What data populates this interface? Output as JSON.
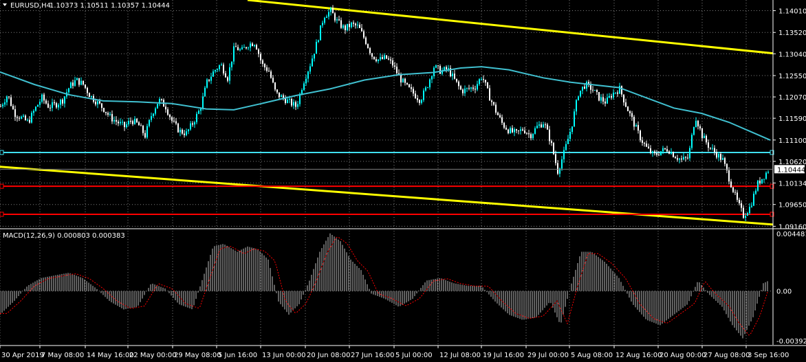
{
  "header": {
    "symbol": "EURUSD,H4",
    "ohlc": "1.10373 1.10511 1.10357 1.10444",
    "dropdown_icon": "triangle-down-icon"
  },
  "colors": {
    "background": "#000000",
    "grid": "#808080",
    "bull_candle": "#00FFFF",
    "bear_candle": "#FFFFFF",
    "ma_line": "#40C0D0",
    "trendline": "#FFFF00",
    "support_line": "#FF0000",
    "resistance_line": "#40E0F0",
    "macd_hist": "#C0C0C0",
    "macd_signal": "#FF0000",
    "price_tag": "#FFFFFF"
  },
  "chart_data": {
    "type": "candlestick",
    "symbol": "EURUSD",
    "timeframe": "H4",
    "price_axis": {
      "ticks": [
        "1.14010",
        "1.13520",
        "1.13040",
        "1.12550",
        "1.12070",
        "1.11590",
        "1.11100",
        "1.10620",
        "1.10134",
        "1.09650",
        "1.09160"
      ],
      "range": [
        1.0912,
        1.1425
      ],
      "current_price": "1.10444"
    },
    "time_axis": {
      "ticks": [
        "30 Apr 2019",
        "7 May 08:00",
        "14 May 16:00",
        "22 May 00:00",
        "29 May 08:00",
        "5 Jun 16:00",
        "13 Jun 00:00",
        "20 Jun 08:00",
        "27 Jun 16:00",
        "5 Jul 00:00",
        "12 Jul 08:00",
        "19 Jul 16:00",
        "29 Jul 00:00",
        "5 Aug 08:00",
        "12 Aug 16:00",
        "20 Aug 00:00",
        "27 Aug 08:00",
        "3 Sep 16:00"
      ]
    },
    "close_path": [
      [
        0,
        1.1186
      ],
      [
        10,
        1.1212
      ],
      [
        20,
        1.117
      ],
      [
        30,
        1.116
      ],
      [
        40,
        1.115
      ],
      [
        50,
        1.118
      ],
      [
        60,
        1.1205
      ],
      [
        70,
        1.1185
      ],
      [
        80,
        1.119
      ],
      [
        90,
        1.12
      ],
      [
        100,
        1.123
      ],
      [
        110,
        1.1245
      ],
      [
        120,
        1.1235
      ],
      [
        130,
        1.121
      ],
      [
        140,
        1.1195
      ],
      [
        150,
        1.118
      ],
      [
        160,
        1.116
      ],
      [
        170,
        1.115
      ],
      [
        180,
        1.114
      ],
      [
        190,
        1.1155
      ],
      [
        200,
        1.1145
      ],
      [
        210,
        1.112
      ],
      [
        220,
        1.117
      ],
      [
        230,
        1.12
      ],
      [
        240,
        1.1185
      ],
      [
        250,
        1.115
      ],
      [
        260,
        1.113
      ],
      [
        270,
        1.1125
      ],
      [
        280,
        1.115
      ],
      [
        290,
        1.118
      ],
      [
        300,
        1.124
      ],
      [
        310,
        1.1265
      ],
      [
        320,
        1.128
      ],
      [
        330,
        1.125
      ],
      [
        340,
        1.132
      ],
      [
        350,
        1.131
      ],
      [
        360,
        1.1325
      ],
      [
        370,
        1.133
      ],
      [
        380,
        1.128
      ],
      [
        390,
        1.1265
      ],
      [
        400,
        1.1215
      ],
      [
        410,
        1.1205
      ],
      [
        420,
        1.1195
      ],
      [
        430,
        1.1185
      ],
      [
        440,
        1.124
      ],
      [
        450,
        1.128
      ],
      [
        460,
        1.133
      ],
      [
        470,
        1.139
      ],
      [
        480,
        1.14
      ],
      [
        490,
        1.1375
      ],
      [
        500,
        1.136
      ],
      [
        510,
        1.137
      ],
      [
        520,
        1.1365
      ],
      [
        530,
        1.1335
      ],
      [
        540,
        1.13
      ],
      [
        550,
        1.129
      ],
      [
        560,
        1.1295
      ],
      [
        570,
        1.128
      ],
      [
        580,
        1.125
      ],
      [
        590,
        1.123
      ],
      [
        600,
        1.1215
      ],
      [
        610,
        1.12
      ],
      [
        620,
        1.123
      ],
      [
        630,
        1.1275
      ],
      [
        640,
        1.1265
      ],
      [
        650,
        1.127
      ],
      [
        660,
        1.1245
      ],
      [
        670,
        1.122
      ],
      [
        680,
        1.1225
      ],
      [
        690,
        1.123
      ],
      [
        700,
        1.1255
      ],
      [
        710,
        1.121
      ],
      [
        720,
        1.1175
      ],
      [
        730,
        1.1145
      ],
      [
        740,
        1.113
      ],
      [
        750,
        1.1125
      ],
      [
        760,
        1.1135
      ],
      [
        770,
        1.112
      ],
      [
        780,
        1.114
      ],
      [
        790,
        1.115
      ],
      [
        800,
        1.1105
      ],
      [
        810,
        1.104
      ],
      [
        820,
        1.1085
      ],
      [
        830,
        1.114
      ],
      [
        840,
        1.1215
      ],
      [
        850,
        1.1235
      ],
      [
        860,
        1.1225
      ],
      [
        870,
        1.1205
      ],
      [
        880,
        1.1195
      ],
      [
        890,
        1.1215
      ],
      [
        900,
        1.1225
      ],
      [
        910,
        1.1185
      ],
      [
        920,
        1.115
      ],
      [
        930,
        1.1115
      ],
      [
        940,
        1.109
      ],
      [
        950,
        1.1075
      ],
      [
        960,
        1.1085
      ],
      [
        970,
        1.109
      ],
      [
        980,
        1.1075
      ],
      [
        990,
        1.1065
      ],
      [
        1000,
        1.107
      ],
      [
        1010,
        1.1165
      ],
      [
        1020,
        1.112
      ],
      [
        1030,
        1.1095
      ],
      [
        1040,
        1.108
      ],
      [
        1050,
        1.1065
      ],
      [
        1060,
        1.102
      ],
      [
        1070,
        1.0975
      ],
      [
        1080,
        1.094
      ],
      [
        1090,
        1.096
      ],
      [
        1100,
        1.101
      ],
      [
        1110,
        1.103
      ],
      [
        1117,
        1.10444
      ]
    ],
    "ma_path": [
      [
        0,
        1.1263
      ],
      [
        50,
        1.1235
      ],
      [
        100,
        1.1212
      ],
      [
        150,
        1.1198
      ],
      [
        200,
        1.1196
      ],
      [
        250,
        1.1192
      ],
      [
        300,
        1.118
      ],
      [
        340,
        1.1178
      ],
      [
        380,
        1.1192
      ],
      [
        430,
        1.121
      ],
      [
        480,
        1.1225
      ],
      [
        530,
        1.1245
      ],
      [
        580,
        1.1257
      ],
      [
        630,
        1.1262
      ],
      [
        670,
        1.1272
      ],
      [
        700,
        1.1275
      ],
      [
        740,
        1.1268
      ],
      [
        790,
        1.125
      ],
      [
        830,
        1.124
      ],
      [
        870,
        1.1233
      ],
      [
        900,
        1.1228
      ],
      [
        940,
        1.1205
      ],
      [
        980,
        1.1182
      ],
      [
        1020,
        1.117
      ],
      [
        1060,
        1.115
      ],
      [
        1090,
        1.113
      ],
      [
        1120,
        1.111
      ]
    ],
    "lines": [
      {
        "kind": "trendline",
        "color": "#FFFF00",
        "points": [
          [
            360,
            1.1425
          ],
          [
            1124,
            1.1305
          ]
        ]
      },
      {
        "kind": "trendline",
        "color": "#FFFF00",
        "points": [
          [
            0,
            1.105
          ],
          [
            1124,
            1.092
          ]
        ]
      },
      {
        "kind": "horizontal",
        "color": "#40E0F0",
        "price": 1.1082
      },
      {
        "kind": "horizontal",
        "color": "#FF0000",
        "price": 1.1006
      },
      {
        "kind": "horizontal",
        "color": "#FF0000",
        "price": 1.0943
      }
    ],
    "macd": {
      "label": "MACD(12,26,9) 0.000803 0.000383",
      "ticks": [
        "0.004481",
        "0.00",
        "-0.003925"
      ],
      "range": [
        -0.0041,
        0.0047
      ],
      "hist_path": [
        [
          0,
          -0.0018
        ],
        [
          20,
          -0.0008
        ],
        [
          40,
          0.0004
        ],
        [
          60,
          0.001
        ],
        [
          80,
          0.0012
        ],
        [
          100,
          0.0014
        ],
        [
          120,
          0.001
        ],
        [
          140,
          0.0002
        ],
        [
          160,
          -0.0008
        ],
        [
          180,
          -0.0014
        ],
        [
          200,
          -0.0012
        ],
        [
          220,
          0.0006
        ],
        [
          240,
          0.0002
        ],
        [
          260,
          -0.001
        ],
        [
          280,
          -0.0014
        ],
        [
          295,
          0.001
        ],
        [
          310,
          0.0034
        ],
        [
          325,
          0.0036
        ],
        [
          345,
          0.003
        ],
        [
          360,
          0.0034
        ],
        [
          375,
          0.0032
        ],
        [
          390,
          0.0024
        ],
        [
          405,
          -0.0008
        ],
        [
          420,
          -0.0018
        ],
        [
          435,
          -0.001
        ],
        [
          450,
          0.0008
        ],
        [
          465,
          0.003
        ],
        [
          480,
          0.0044
        ],
        [
          495,
          0.0038
        ],
        [
          510,
          0.0024
        ],
        [
          525,
          0.0016
        ],
        [
          540,
          -0.0002
        ],
        [
          560,
          -0.0006
        ],
        [
          580,
          -0.0012
        ],
        [
          600,
          -0.0006
        ],
        [
          620,
          0.0008
        ],
        [
          640,
          0.001
        ],
        [
          660,
          0.0006
        ],
        [
          680,
          0.0004
        ],
        [
          700,
          0.0004
        ],
        [
          720,
          -0.0008
        ],
        [
          740,
          -0.0018
        ],
        [
          760,
          -0.0022
        ],
        [
          780,
          -0.002
        ],
        [
          800,
          -0.0008
        ],
        [
          815,
          -0.0026
        ],
        [
          830,
          0.0004
        ],
        [
          845,
          0.003
        ],
        [
          860,
          0.003
        ],
        [
          880,
          0.0022
        ],
        [
          900,
          0.001
        ],
        [
          920,
          -0.001
        ],
        [
          940,
          -0.0022
        ],
        [
          960,
          -0.0026
        ],
        [
          980,
          -0.0018
        ],
        [
          1000,
          -0.001
        ],
        [
          1015,
          0.0008
        ],
        [
          1030,
          -0.0002
        ],
        [
          1050,
          -0.0012
        ],
        [
          1065,
          -0.0026
        ],
        [
          1080,
          -0.0036
        ],
        [
          1095,
          -0.002
        ],
        [
          1110,
          0.0006
        ],
        [
          1118,
          0.0008
        ]
      ]
    }
  }
}
